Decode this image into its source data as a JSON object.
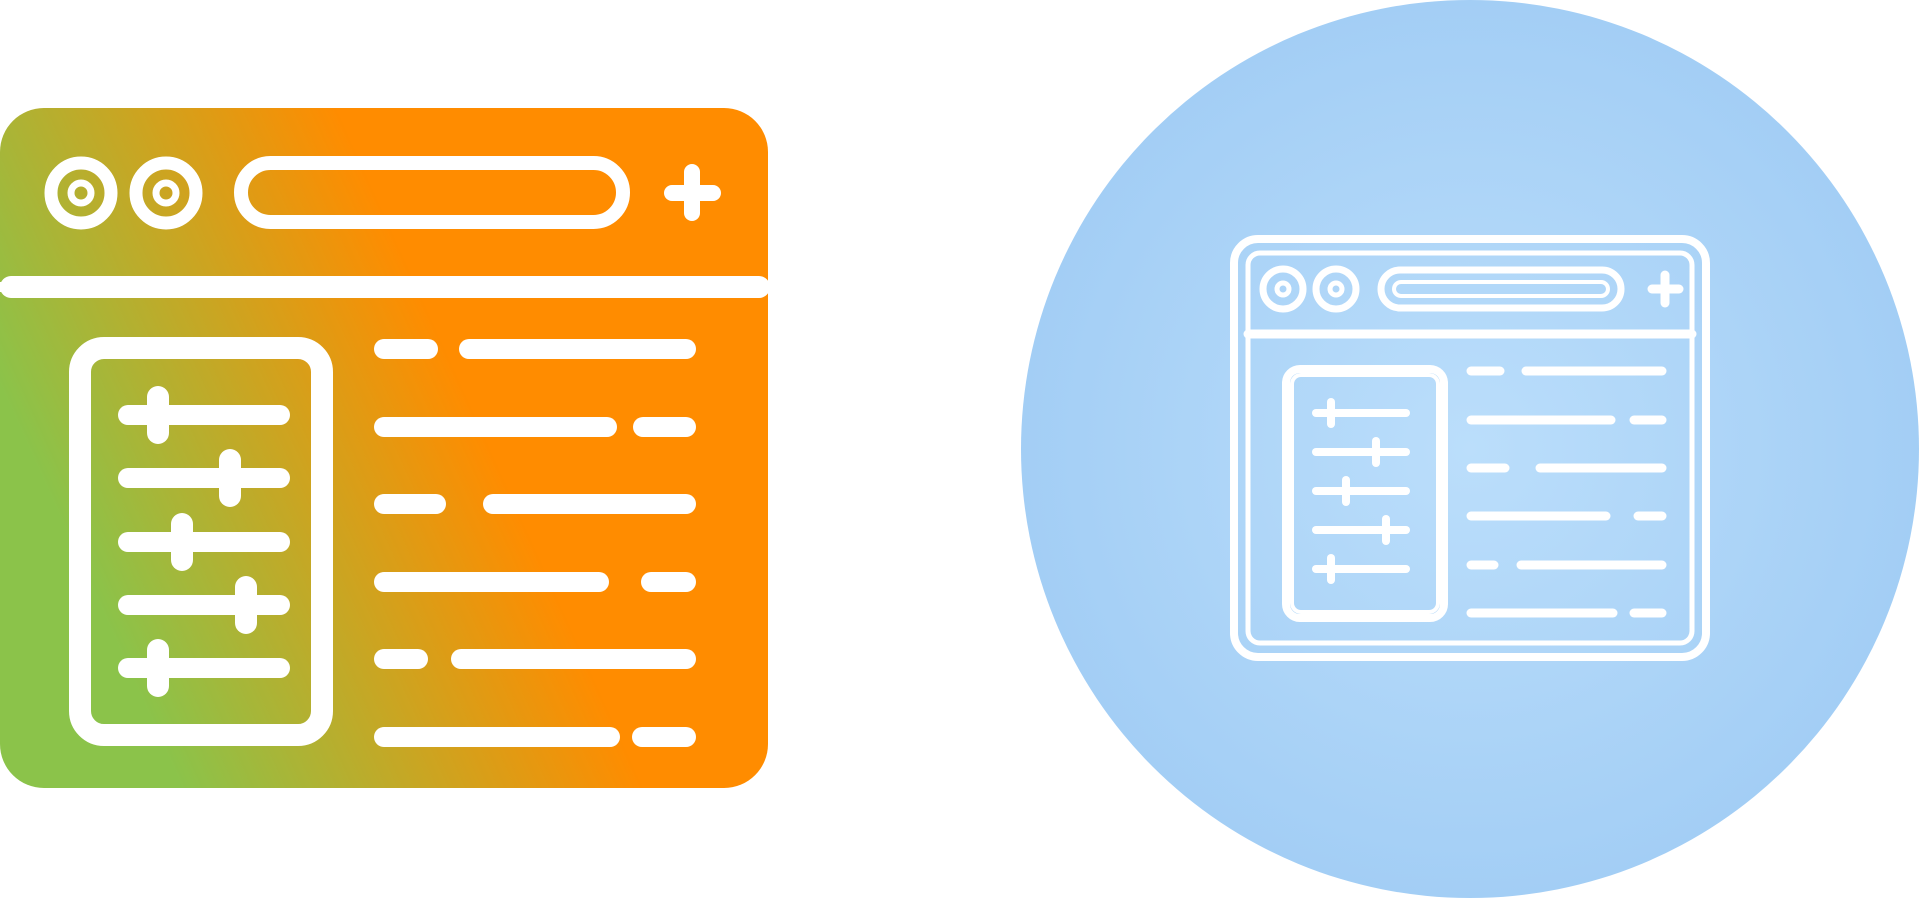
{
  "icons": [
    {
      "name": "settings-browser-window-icon",
      "style": "glyph-gradient",
      "gradient_colors": [
        "#8BC34A",
        "#FF8C00"
      ],
      "foreground_color": "#ffffff",
      "window_buttons": 2,
      "slider_rows": 5,
      "text_rows": 6
    },
    {
      "name": "settings-browser-window-icon",
      "style": "outline-in-circle",
      "circle_colors": [
        "#BBDEFB",
        "#A3CEF5"
      ],
      "foreground_color": "#ffffff",
      "window_buttons": 2,
      "slider_rows": 5,
      "text_rows": 6
    }
  ]
}
